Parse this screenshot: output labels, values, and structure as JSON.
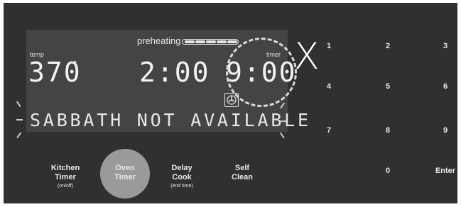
{
  "display": {
    "preheating_label": "preheating",
    "temp_label": "temp",
    "timer_label": "timer",
    "temp_value": "370",
    "temp_unit": "°",
    "cook_time": "2:00",
    "timer_value": "9:00",
    "message": "SABBATH NOT AVAILABLE",
    "preheat_progress_segments": 5
  },
  "annotation": {
    "mark": "X"
  },
  "keypad": {
    "keys": [
      "1",
      "2",
      "3",
      "4",
      "5",
      "6",
      "7",
      "8",
      "9",
      "0",
      "Enter"
    ]
  },
  "buttons": {
    "kitchen_timer": {
      "line1": "Kitchen",
      "line2": "Timer",
      "sub": "(on/off)"
    },
    "oven_timer": {
      "line1": "Oven",
      "line2": "Timer"
    },
    "delay_cook": {
      "line1": "Delay",
      "line2": "Cook",
      "sub": "(end time)"
    },
    "self_clean": {
      "line1": "Self",
      "line2": "Clean"
    }
  },
  "colors": {
    "panel": "#303030",
    "display": "#444444",
    "active_button": "#9a9a9a",
    "text": "#e8e8e8"
  }
}
